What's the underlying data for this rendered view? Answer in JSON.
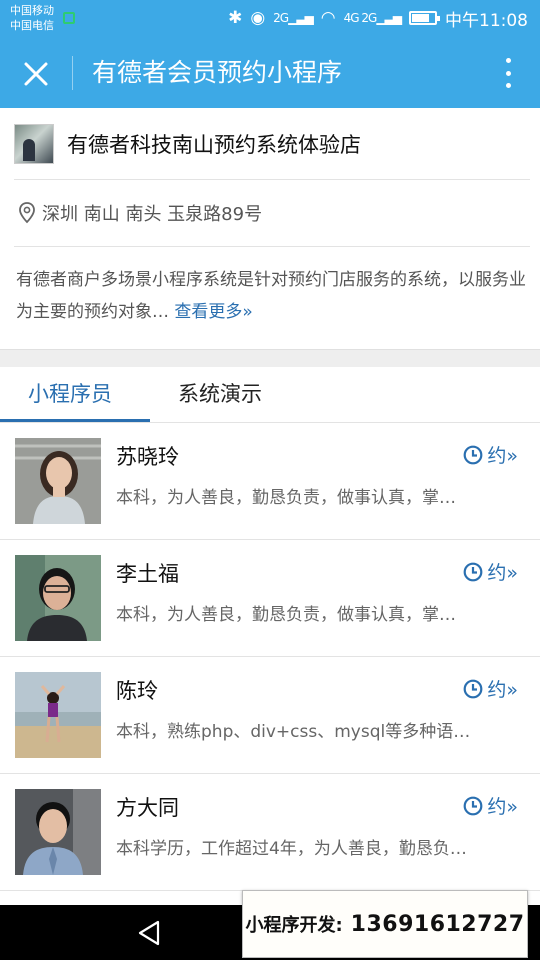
{
  "status_bar": {
    "carrier_1": "中国移动",
    "carrier_2": "中国电信",
    "time": "中午11:08",
    "signal_1_label": "2G",
    "signal_2_label": "4G 2G",
    "battery_level": 0.7
  },
  "title_bar": {
    "title": "有德者会员预约小程序"
  },
  "store": {
    "name": "有德者科技南山预约系统体验店",
    "address": "深圳 南山 南头 玉泉路89号",
    "description": "有德者商户多场景小程序系统是针对预约门店服务的系统，以服务业为主要的预约对象…",
    "more_link": "查看更多"
  },
  "tabs": [
    {
      "label": "小程序员",
      "active": true
    },
    {
      "label": "系统演示",
      "active": false
    }
  ],
  "staff": [
    {
      "name": "苏晓玲",
      "desc": "本科，为人善良，勤恳负责，做事认真，掌…",
      "book_label": "约»"
    },
    {
      "name": "李土福",
      "desc": "本科，为人善良，勤恳负责，做事认真，掌…",
      "book_label": "约»"
    },
    {
      "name": "陈玲",
      "desc": "本科，熟练php、div+css、mysql等多种语…",
      "book_label": "约»"
    },
    {
      "name": "方大同",
      "desc": "本科学历，工作超过4年，为人善良，勤恳负…",
      "book_label": "约»"
    }
  ],
  "promo": {
    "label": "小程序开发:",
    "phone": "13691612727"
  },
  "colors": {
    "header": "#3da9e6",
    "accent": "#2a6fb0"
  },
  "icons": [
    "close-icon",
    "more-icon",
    "pin-icon",
    "clock-icon",
    "back-icon"
  ]
}
